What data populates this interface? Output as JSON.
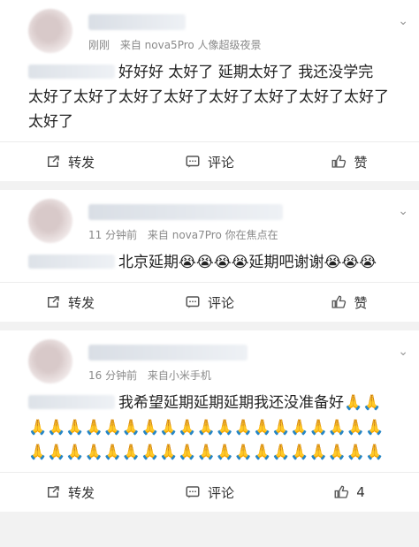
{
  "posts": [
    {
      "time": "刚刚",
      "source": "来自 nova5Pro 人像超级夜景",
      "text": "好好好 太好了 延期太好了 我还没学完 太好了太好了太好了太好了太好了太好了太好了太好了太好了",
      "actions": {
        "repost": "转发",
        "comment": "评论",
        "like": "赞"
      }
    },
    {
      "time": "11 分钟前",
      "source": "来自 nova7Pro 你在焦点在",
      "text": "北京延期😭😭😭😭延期吧谢谢😭😭😭",
      "actions": {
        "repost": "转发",
        "comment": "评论",
        "like": "赞"
      }
    },
    {
      "time": "16 分钟前",
      "source": "来自小米手机",
      "text": "我希望延期延期延期我还没准备好🙏🙏🙏🙏🙏🙏🙏🙏🙏🙏🙏🙏🙏🙏🙏🙏🙏🙏🙏🙏🙏🙏🙏🙏🙏🙏🙏🙏🙏🙏🙏🙏🙏🙏🙏🙏🙏🙏🙏🙏",
      "actions": {
        "repost": "转发",
        "comment": "评论",
        "like_count": "4"
      }
    }
  ]
}
